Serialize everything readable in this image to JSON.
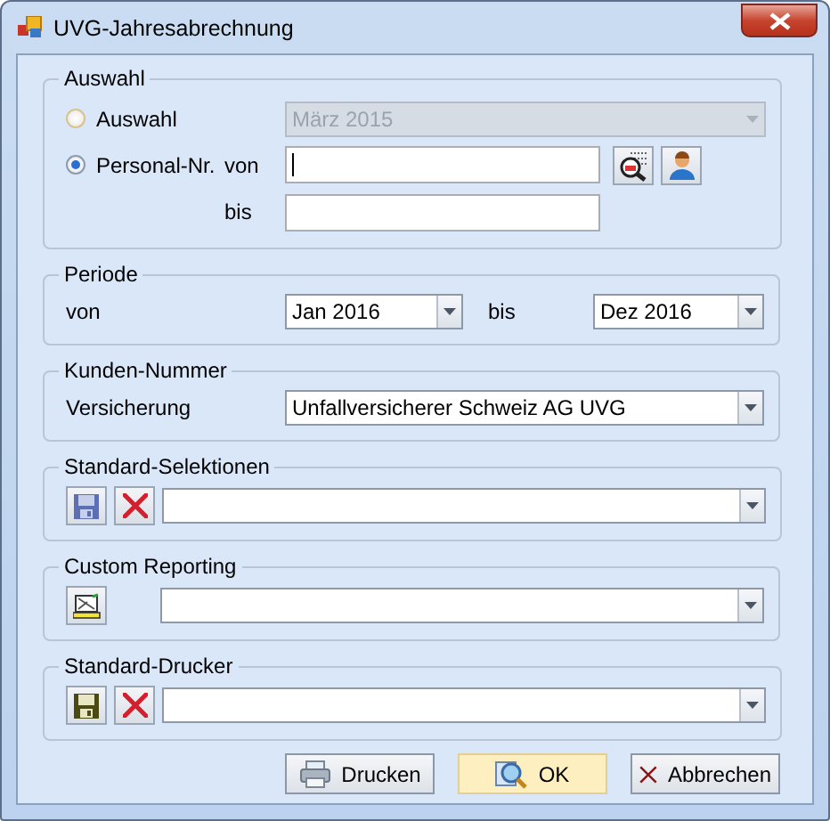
{
  "window": {
    "title": "UVG-Jahresabrechnung"
  },
  "auswahl": {
    "title": "Auswahl",
    "options": [
      {
        "label": "Auswahl",
        "selected": false
      },
      {
        "label": "Personal-Nr.",
        "selected": true
      }
    ],
    "month_select": {
      "value": "März 2015",
      "disabled": true
    },
    "from_field": {
      "label": "von",
      "focused": true
    },
    "to_field": {
      "label": "bis",
      "focused": false
    }
  },
  "periode": {
    "title": "Periode",
    "from_label": "von",
    "from_value": "Jan 2016",
    "to_label": "bis",
    "to_value": "Dez 2016"
  },
  "kunden": {
    "title": "Kunden-Nummer",
    "label": "Versicherung",
    "value": "Unfallversicherer Schweiz AG UVG"
  },
  "tool_groups": [
    {
      "title": "Standard-Selektionen",
      "tools": [
        {
          "kind": "save",
          "disabled": true
        },
        {
          "kind": "delete",
          "disabled": false
        }
      ]
    },
    {
      "title": "Custom Reporting",
      "tools": [
        {
          "kind": "report",
          "disabled": false
        }
      ]
    },
    {
      "title": "Standard-Drucker",
      "tools": [
        {
          "kind": "save",
          "disabled": false
        },
        {
          "kind": "delete",
          "disabled": false
        }
      ]
    }
  ],
  "buttons": [
    {
      "label": "Drucken",
      "kind": "print",
      "default": false
    },
    {
      "label": "OK",
      "kind": "ok",
      "default": true
    },
    {
      "label": "Abbrechen",
      "kind": "cancel",
      "default": false
    }
  ]
}
